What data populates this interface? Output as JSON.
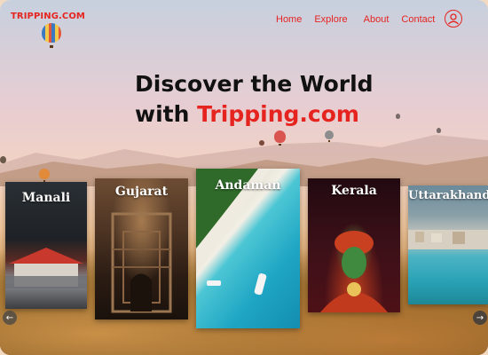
{
  "brand": {
    "logo": "TRIPPING.COM"
  },
  "nav": {
    "items": [
      {
        "label": "Home"
      },
      {
        "label": "Explore"
      },
      {
        "label": "About"
      },
      {
        "label": "Contact"
      }
    ],
    "profile_icon": "user-circle-icon"
  },
  "hero": {
    "line1": "Discover the World",
    "line2_prefix": "with ",
    "line2_brand": "Tripping.com"
  },
  "destinations": [
    {
      "name": "Manali"
    },
    {
      "name": "Gujarat"
    },
    {
      "name": "Andaman"
    },
    {
      "name": "Kerala"
    },
    {
      "name": "Uttarakhand"
    }
  ],
  "carousel": {
    "prev_icon": "arrow-left-icon",
    "next_icon": "arrow-right-icon"
  },
  "colors": {
    "accent": "#e52420",
    "heading": "#111111"
  }
}
